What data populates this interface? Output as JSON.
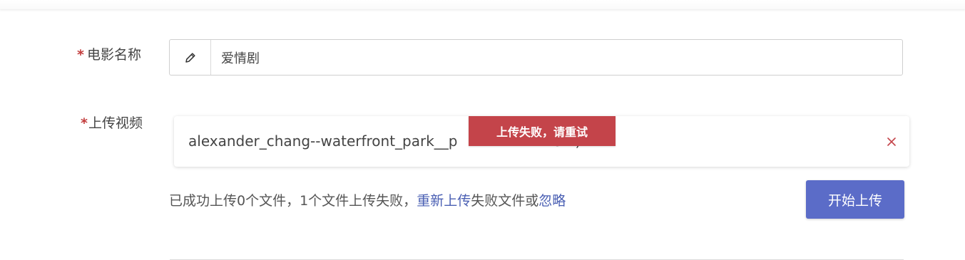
{
  "form": {
    "movie_name": {
      "required_mark": "*",
      "label": "电影名称",
      "value": "爱情剧",
      "addon_icon": "pencil-icon"
    },
    "video_upload": {
      "required_mark": "*",
      "label": "上传视频",
      "file": {
        "name_visible": "alexander_chang--waterfront_park__p",
        "name_tail_visible": "3M)",
        "remove_icon": "close-icon"
      },
      "error_banner": "上传失败，请重试",
      "status": {
        "prefix": "已成功上传0个文件，1个文件上传失败，",
        "retry_link": "重新上传",
        "middle": "失败文件或",
        "ignore_link": "忽略"
      },
      "start_button": "开始上传"
    }
  },
  "colors": {
    "required": "#c23b3b",
    "primary": "#5b6cc8",
    "error": "#c4444a",
    "link": "#4a5fb3"
  }
}
